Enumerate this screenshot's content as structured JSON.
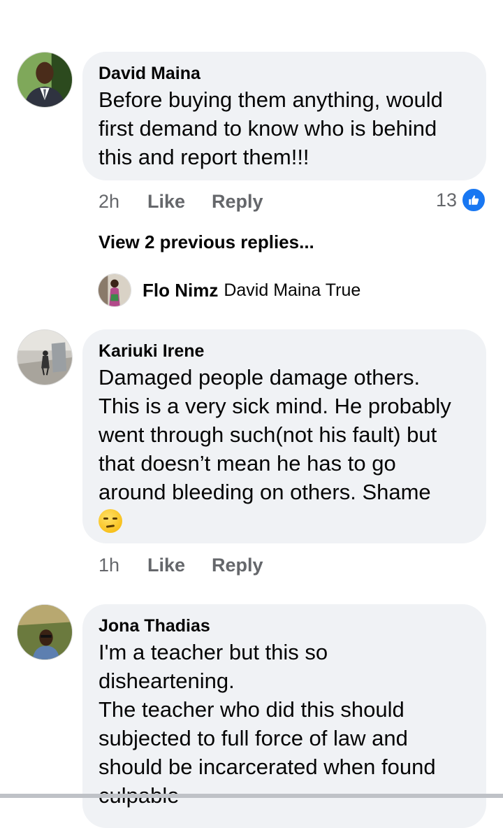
{
  "comments": [
    {
      "author": "David Maina",
      "text": "Before buying them anything, would\nfirst demand to know who is behind\nthis and report them!!!",
      "time": "2h",
      "like_label": "Like",
      "reply_label": "Reply",
      "reaction_count": "13",
      "reaction_icon": "like-icon",
      "view_replies": "View 2 previous replies...",
      "reply": {
        "author": "Flo Nimz",
        "text": "David Maina True"
      }
    },
    {
      "author": "Kariuki Irene",
      "text": "Damaged people damage others.\nThis is a very sick mind. He probably\nwent through such(not his fault) but\nthat doesn’t mean he has to go\naround bleeding on others. Shame",
      "emoji": "unamused-face-emoji",
      "time": "1h",
      "like_label": "Like",
      "reply_label": "Reply"
    },
    {
      "author": "Jona Thadias",
      "text": "I'm a teacher but this so\ndisheartening.\nThe teacher who did this should\nsubjected to full force of law and\nshould be incarcerated when found\nculpable"
    }
  ],
  "colors": {
    "bubble": "#f0f2f5",
    "meta_text": "#65676b",
    "like_blue": "#1877f2"
  }
}
